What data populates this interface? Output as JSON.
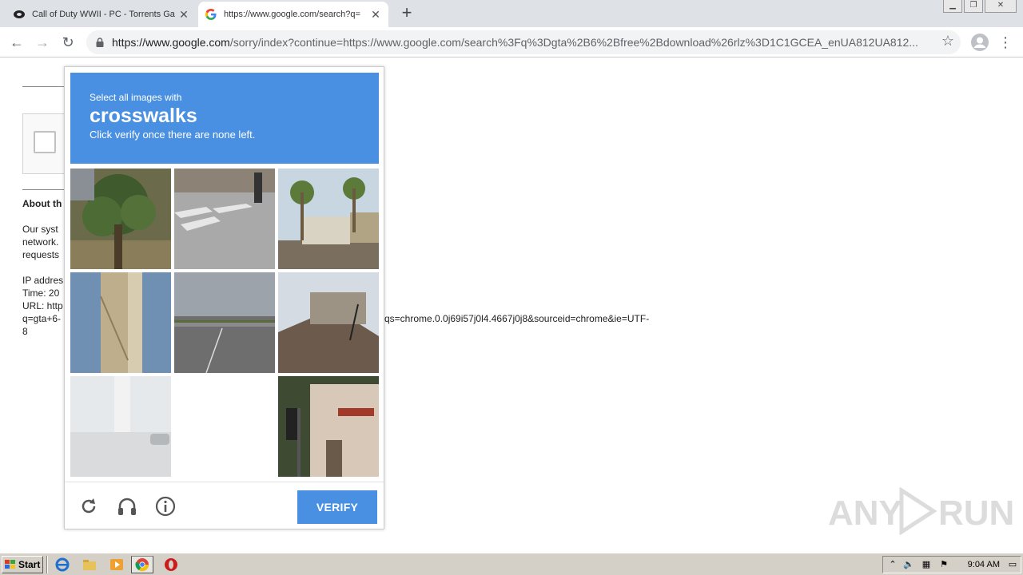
{
  "browser": {
    "tabs": [
      {
        "title": "Call of Duty WWII - PC - Torrents Ga",
        "icon": "app-icon"
      },
      {
        "title": "https://www.google.com/search?q=",
        "icon": "google-icon"
      }
    ],
    "url_host": "https://www.google.com",
    "url_rest": "/sorry/index?continue=https://www.google.com/search%3Fq%3Dgta%2B6%2Bfree%2Bdownload%26rlz%3D1C1GCEA_enUA812UA812..."
  },
  "page": {
    "about_heading": "About th",
    "para1": [
      "Our syst",
      "network.",
      "requests"
    ],
    "para2": [
      "IP addres",
      "Time: 20",
      "URL: http",
      "q=gta+6-",
      "8"
    ],
    "url_tail": "qs=chrome.0.0j69i57j0l4.4667j0j8&sourceid=chrome&ie=UTF-"
  },
  "captcha": {
    "instruction": "Select all images with",
    "keyword": "crosswalks",
    "hint": "Click verify once there are none left.",
    "verify_label": "VERIFY",
    "tiles": [
      "palm-tree",
      "crosswalk",
      "palm-houses",
      "bridge-tower",
      "highway",
      "roof",
      "bridge-road",
      "blank",
      "storefront"
    ]
  },
  "watermark": {
    "text_left": "ANY",
    "text_right": "RUN"
  },
  "taskbar": {
    "start_label": "Start",
    "clock": "9:04 AM"
  },
  "colors": {
    "captcha_blue": "#4a90e2",
    "taskbar": "#d4d0c8",
    "tabstrip": "#dee1e6"
  }
}
